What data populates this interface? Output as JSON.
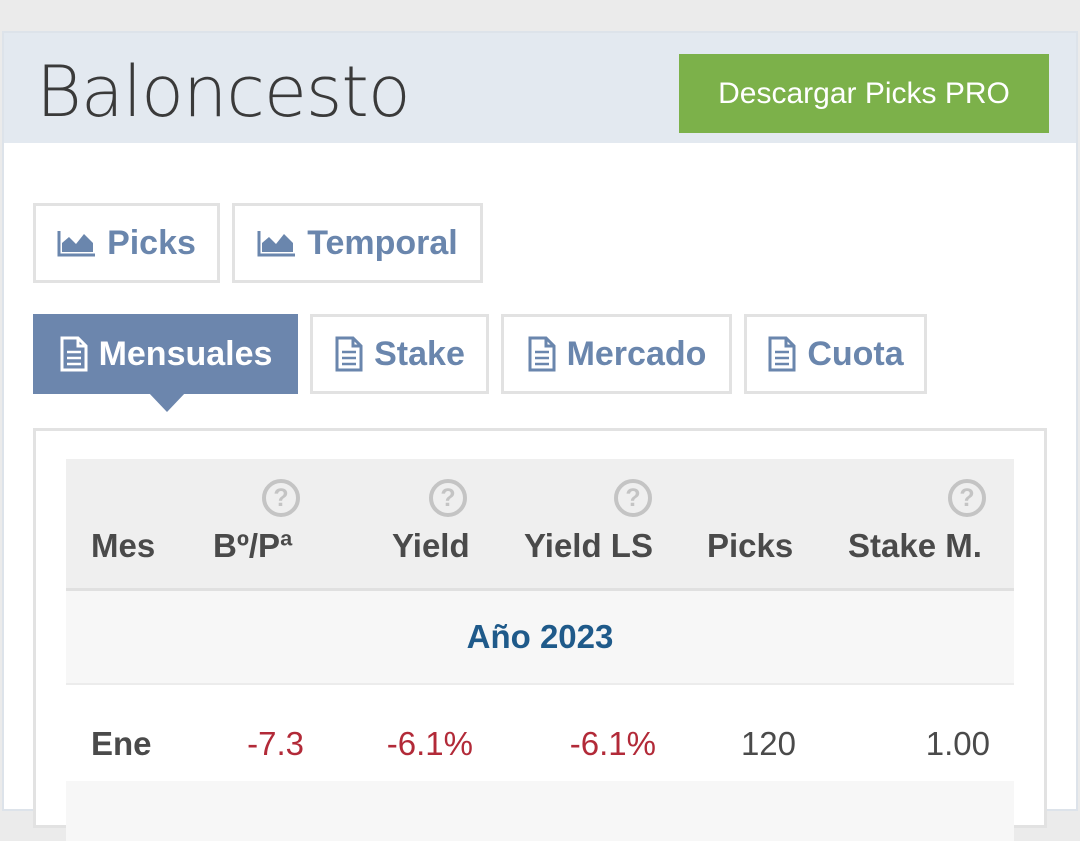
{
  "header": {
    "title": "Baloncesto",
    "pro_button": "Descargar Picks PRO"
  },
  "chart_tabs": [
    {
      "label": "Picks",
      "icon": "area-chart-icon"
    },
    {
      "label": "Temporal",
      "icon": "area-chart-icon"
    }
  ],
  "report_tabs": [
    {
      "label": "Mensuales",
      "icon": "document-icon",
      "active": true
    },
    {
      "label": "Stake",
      "icon": "document-icon",
      "active": false
    },
    {
      "label": "Mercado",
      "icon": "document-icon",
      "active": false
    },
    {
      "label": "Cuota",
      "icon": "document-icon",
      "active": false
    }
  ],
  "table": {
    "columns": [
      "Mes",
      "Bº/Pª",
      "Yield",
      "Yield LS",
      "Picks",
      "Stake M."
    ],
    "help_glyph": "?",
    "year_label": "Año 2023",
    "rows": [
      {
        "mes": "Ene",
        "bp": "-7.3",
        "yield": "-6.1%",
        "yield_ls": "-6.1%",
        "picks": "120",
        "stake": "1.00"
      }
    ]
  },
  "colors": {
    "accent": "#6c86ad",
    "pro_button": "#7cb14a",
    "negative": "#b22a38",
    "year": "#1f5a8a"
  }
}
